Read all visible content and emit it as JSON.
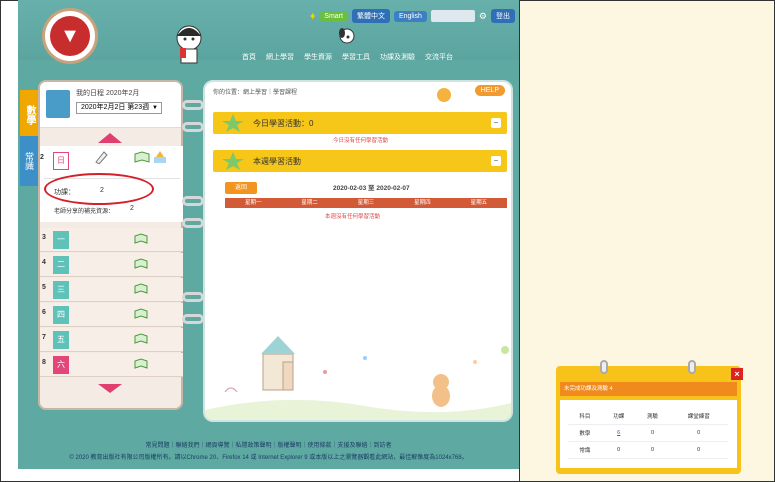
{
  "top": {
    "lang_traditional": "繁體中文",
    "lang_english": "English",
    "smart": "Smart",
    "logout": "登出"
  },
  "nav": [
    "首頁",
    "網上學習",
    "學生資源",
    "學習工具",
    "功課及測驗",
    "交流平台"
  ],
  "diary": {
    "title": "我的日程 2020年2月",
    "week_select": "2020年2月2日 第23週"
  },
  "sidetabs": {
    "subject": "數學",
    "other": "常識"
  },
  "today": {
    "num": "2",
    "day": "日",
    "homework_label": "功課：",
    "homework_value": "2",
    "share_label": "老師分享的補充資源：",
    "share_value": "2"
  },
  "days": [
    {
      "num": "3",
      "day": "一"
    },
    {
      "num": "4",
      "day": "二"
    },
    {
      "num": "5",
      "day": "三"
    },
    {
      "num": "6",
      "day": "四"
    },
    {
      "num": "7",
      "day": "五"
    },
    {
      "num": "8",
      "day": "六"
    }
  ],
  "main": {
    "breadcrumb": "你的位置：網上學習｜學習課程",
    "help": "HELP",
    "today_title": "今日學習活動：0",
    "today_note": "今日沒有任何學習活動",
    "week_title": "本週學習活動",
    "back": "返回",
    "range": "2020-02-03 至 2020-02-07",
    "week_days": [
      "星期一",
      "星期二",
      "星期三",
      "星期四",
      "星期五"
    ],
    "week_note": "本週沒有任何學習活動"
  },
  "footer": {
    "links": "常見問題｜聯絡我們｜網頁導覽｜私隱政策聲明｜版權聲明｜使用條款｜支援及聯絡｜到訪者",
    "copyright": "© 2020 教育出版社有限公司版權所有。請以Chrome 20、Firefox 14 或 Internet Explorer 9 或本版以上之瀏覽器觀看此網站，最佳解像度為1024x768。"
  },
  "popup": {
    "title": "未完成功課及測驗 4",
    "headers": [
      "科目",
      "功課",
      "測驗",
      "課堂練習"
    ],
    "rows": [
      [
        "數學",
        "6",
        "0",
        "0"
      ],
      [
        "常識",
        "0",
        "0",
        "0"
      ]
    ]
  }
}
